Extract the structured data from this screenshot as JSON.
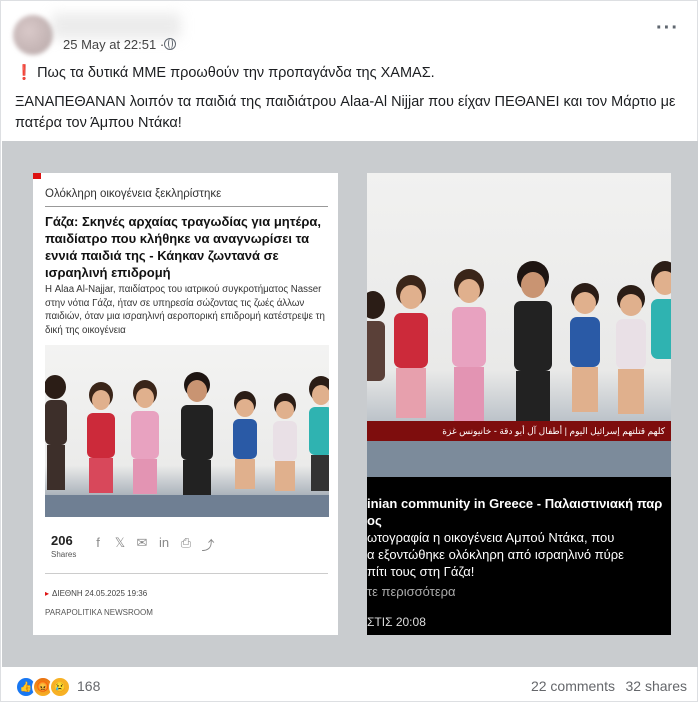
{
  "post": {
    "timestamp": "25 May at 22:51 ·",
    "caption_line1": "❗ Πως τα δυτικά ΜΜΕ προωθούν την προπαγάνδα της ΧΑΜΑΣ.",
    "caption_line2": "ΞΑΝΑΠΕΘΑΝΑΝ λοιπόν τα παιδιά της παιδιάτρου Alaa-Al Nijjar που είχαν ΠΕΘΑΝΕΙ  και  τον Μάρτιο με πατέρα τον Άμπου Ντάκα!",
    "more_icon": "more-options-icon"
  },
  "left_card": {
    "rubric": "Ολόκληρη οικογένεια ξεκληρίστηκε",
    "headline": "Γάζα: Σκηνές αρχαίας τραγωδίας για μητέρα, παιδίατρο που κλήθηκε να αναγνωρίσει τα εννιά παιδιά της - Κάηκαν ζωντανά σε ισραηλινή επιδρομή",
    "lede": "Η Alaa Al-Najjar, παιδίατρος του ιατρικού συγκροτήματος Nasser στην νότια Γάζα, ήταν σε υπηρεσία σώζοντας τις ζωές άλλων παιδιών, όταν μια ισραηλινή αεροπορική επιδρομή κατέστρεψε τη δική της οικογένεια",
    "share_count": "206",
    "share_label": "Shares",
    "share_icons": [
      "facebook-icon",
      "x-icon",
      "mail-icon",
      "linkedin-icon",
      "print-icon",
      "share-icon"
    ],
    "share_glyphs": [
      "f",
      "𝕏",
      "✉",
      "in",
      "⎙",
      "⤴"
    ],
    "section": "ΔΙΕΘΝΗ 24.05.2025 19:36",
    "source": "PARAPOLITIKA NEWSROOM"
  },
  "right_card": {
    "banner": "كلهم قتلتهم إسرائيل اليوم | أطفال آل أبو دقة - خانيونس غزة",
    "title_line1": "inian community in Greece - Παλαιστινιακή παρ",
    "title_line2": "ος",
    "body_line1": "ωτογραφία η οικογένεια Αμπού Ντάκα, που",
    "body_line2": "α εξοντώθηκε ολόκληρη από ισραηλινό πύρε",
    "body_line3": "πίτι τους στη Γάζα!",
    "see_more": "τε περισσότερα",
    "time": "ΣΤΙΣ 20:08"
  },
  "footer": {
    "reaction_icons": [
      "like-icon",
      "angry-icon",
      "sad-icon"
    ],
    "reaction_count": "168",
    "comments": "22 comments",
    "shares": "32 shares"
  },
  "colors": {
    "accent": "#1877f2",
    "banner": "#7e0d0d",
    "media_bg": "#c9cccf"
  }
}
